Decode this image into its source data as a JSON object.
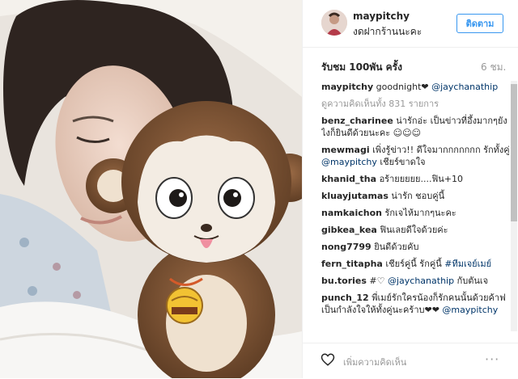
{
  "post": {
    "username": "maypitchy",
    "location": "งดฝากร้านนะคะ",
    "follow_label": "ติดตาม",
    "views": "รับชม 100พัน ครั้ง",
    "time": "6 ชม.",
    "caption": {
      "user": "maypitchy",
      "text": "goodnight❤ ",
      "mention": "@jaychanathip"
    },
    "view_all": "ดูความคิดเห็นทั้ง 831 รายการ",
    "add_comment_placeholder": "เพิ่มความคิดเห็น",
    "more_label": "···"
  },
  "comments": [
    {
      "user": "benz_charinee",
      "text": "น่ารักอ่ะ เป็นข่าวที่อึ้งมากๆยังไงก็ยินดีด้วยนะคะ ☺☺☺"
    },
    {
      "user": "mewmagi",
      "text": "เพิ่งรู้ข่าว!! ดีใจมากกกกกกก รักทั้งคู่ ",
      "mention": "@maypitchy",
      "tail": " เชียร์ขาดใจ"
    },
    {
      "user": "khanid_tha",
      "text": "อร้ายยยยย....ฟิน+10"
    },
    {
      "user": "kluayjutamas",
      "text": "น่ารัก ชอบคู่นี้"
    },
    {
      "user": "namkaichon",
      "text": "รักเจไห้มากๆนะคะ"
    },
    {
      "user": "gibkea_kea",
      "text": "ฟินเลยดีใจด้วยค่ะ"
    },
    {
      "user": "nong7799",
      "text": "ยินดีด้วยคับ"
    },
    {
      "user": "fern_titapha",
      "text": "เชียร์คู่นี้ รักคู่นี้ ",
      "mention": "#ทีมเจย์เมย์"
    },
    {
      "user": "bu.tories",
      "text": "#♡ ",
      "mention": "@jaychanathip",
      "tail": " กับตันเจ"
    },
    {
      "user": "punch_12",
      "text": "พี่เมย์รักใครน้องก็รักคนนั้นด้วยค้าฟเป็นกำลังใจให้ทั้งคู่นะคร้าบ❤❤ ",
      "mention": "@maypitchy"
    }
  ],
  "icons": {
    "heart": "heart-outline-icon",
    "more": "more-dots-icon"
  },
  "colors": {
    "accent": "#3897f0",
    "link": "#003569",
    "muted": "#999999"
  }
}
